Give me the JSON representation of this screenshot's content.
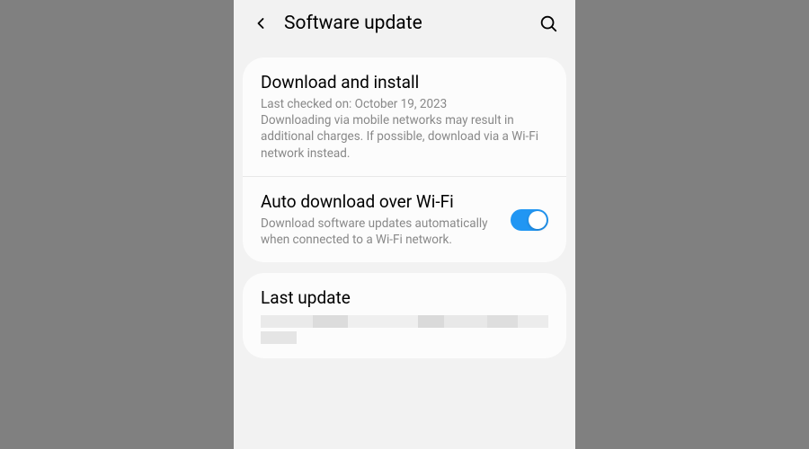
{
  "header": {
    "title": "Software update"
  },
  "sections": {
    "download_install": {
      "title": "Download and install",
      "last_checked": "Last checked on: October 19, 2023",
      "description": "Downloading via mobile networks may result in additional charges. If possible, download via a Wi-Fi network instead."
    },
    "auto_download": {
      "title": "Auto download over Wi-Fi",
      "description": "Download software updates automatically when connected to a Wi-Fi network.",
      "toggle_state": true
    },
    "last_update": {
      "title": "Last update"
    }
  },
  "colors": {
    "accent": "#2196f3"
  }
}
